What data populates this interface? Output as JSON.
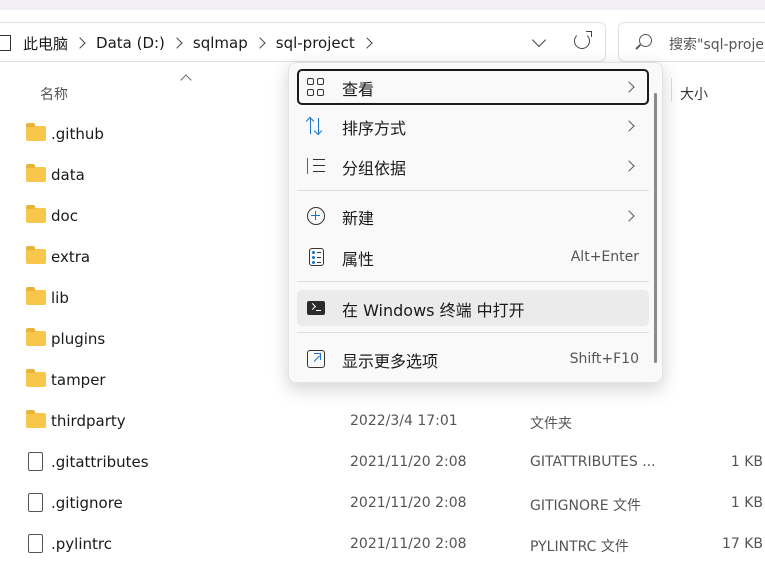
{
  "address": {
    "breadcrumbs": [
      "此电脑",
      "Data (D:)",
      "sqlmap",
      "sql-project"
    ]
  },
  "search": {
    "placeholder": "搜索\"sql-proje"
  },
  "columns": {
    "name": "名称",
    "size": "大小"
  },
  "files": [
    {
      "name": ".github",
      "kind": "folder",
      "date": "",
      "type": "",
      "size": ""
    },
    {
      "name": "data",
      "kind": "folder",
      "date": "",
      "type": "",
      "size": ""
    },
    {
      "name": "doc",
      "kind": "folder",
      "date": "",
      "type": "",
      "size": ""
    },
    {
      "name": "extra",
      "kind": "folder",
      "date": "",
      "type": "",
      "size": ""
    },
    {
      "name": "lib",
      "kind": "folder",
      "date": "",
      "type": "",
      "size": ""
    },
    {
      "name": "plugins",
      "kind": "folder",
      "date": "",
      "type": "",
      "size": ""
    },
    {
      "name": "tamper",
      "kind": "folder",
      "date": "",
      "type": "",
      "size": ""
    },
    {
      "name": "thirdparty",
      "kind": "folder",
      "date": "2022/3/4 17:01",
      "type": "文件夹",
      "size": ""
    },
    {
      "name": ".gitattributes",
      "kind": "file",
      "date": "2021/11/20 2:08",
      "type": "GITATTRIBUTES ...",
      "size": "1 KB"
    },
    {
      "name": ".gitignore",
      "kind": "file",
      "date": "2021/11/20 2:08",
      "type": "GITIGNORE 文件",
      "size": "1 KB"
    },
    {
      "name": ".pylintrc",
      "kind": "file",
      "date": "2021/11/20 2:08",
      "type": "PYLINTRC 文件",
      "size": "17 KB"
    }
  ],
  "context_menu": {
    "view": "查看",
    "sort_by": "排序方式",
    "group_by": "分组依据",
    "new": "新建",
    "properties": "属性",
    "properties_shortcut": "Alt+Enter",
    "open_in_terminal": "在 Windows 终端 中打开",
    "show_more": "显示更多选项",
    "show_more_shortcut": "Shift+F10"
  }
}
